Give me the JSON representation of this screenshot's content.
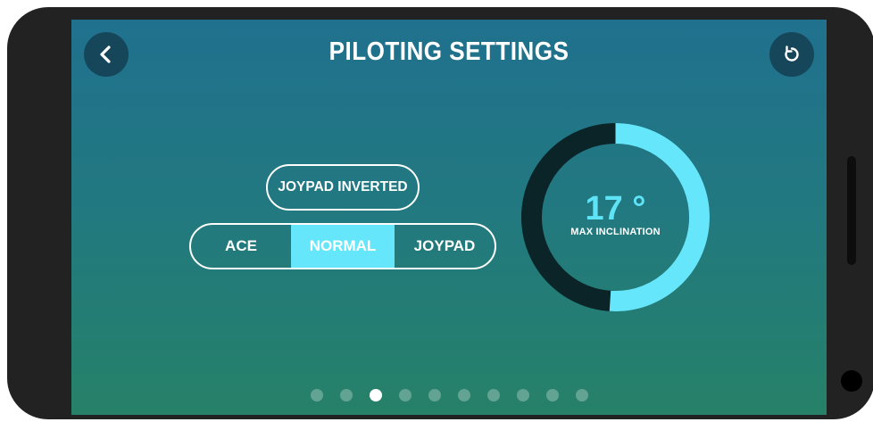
{
  "header": {
    "title": "PILOTING SETTINGS"
  },
  "joypad_inverted": {
    "label": "JOYPAD INVERTED"
  },
  "mode_selector": {
    "options": [
      "ACE",
      "NORMAL",
      "JOYPAD"
    ],
    "selected": "NORMAL"
  },
  "inclination_gauge": {
    "value": "17 °",
    "label": "MAX INCLINATION",
    "fill_fraction": 0.51
  },
  "pagination": {
    "total": 10,
    "current": 3
  },
  "colors": {
    "accent": "#66e6fa",
    "gauge_track": "#0a2428",
    "button_bg": "#16465a",
    "gradient_top": "#20718e",
    "gradient_bottom": "#268168"
  },
  "icons": {
    "back": "chevron-left-icon",
    "reset": "reset-icon"
  }
}
